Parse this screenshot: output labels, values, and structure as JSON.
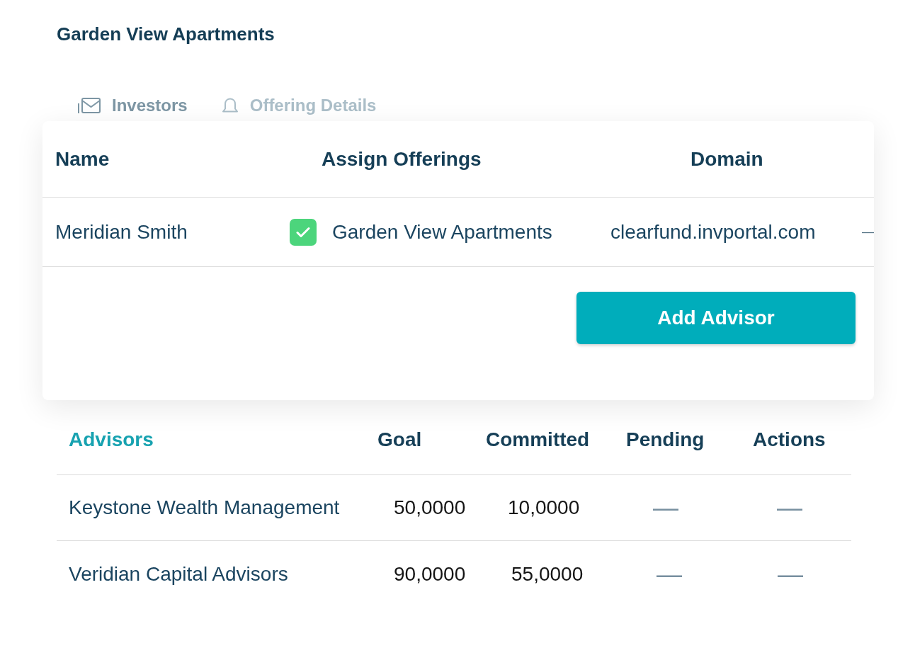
{
  "header": {
    "title": "Garden View Apartments"
  },
  "tabs": [
    {
      "label": "Investors",
      "selected": true
    },
    {
      "label": "Offering Details",
      "selected": false
    }
  ],
  "advisor_form": {
    "columns": [
      "Name",
      "Assign Offerings",
      "Domain"
    ],
    "rows": [
      {
        "name": "Meridian Smith",
        "offering": {
          "label": "Garden View Apartments",
          "checked": true
        },
        "domain": "clearfund.invportal.com",
        "column_4": "—"
      }
    ],
    "button": "Add Advisor"
  },
  "advisors_table": {
    "columns": [
      {
        "label": "Advisors",
        "active": true
      },
      {
        "label": "Goal",
        "active": false
      },
      {
        "label": "Committed",
        "active": false
      },
      {
        "label": "Pending",
        "active": false
      },
      {
        "label": "Actions",
        "active": false
      }
    ],
    "rows": [
      {
        "advisor": "Keystone Wealth Management",
        "goal": "50,0000",
        "committed": "10,0000",
        "pending": "—",
        "actions": "—"
      },
      {
        "advisor": "Veridian Capital Advisors",
        "goal": "90,0000",
        "committed": "55,0000",
        "pending": "—",
        "actions": "—"
      }
    ]
  }
}
